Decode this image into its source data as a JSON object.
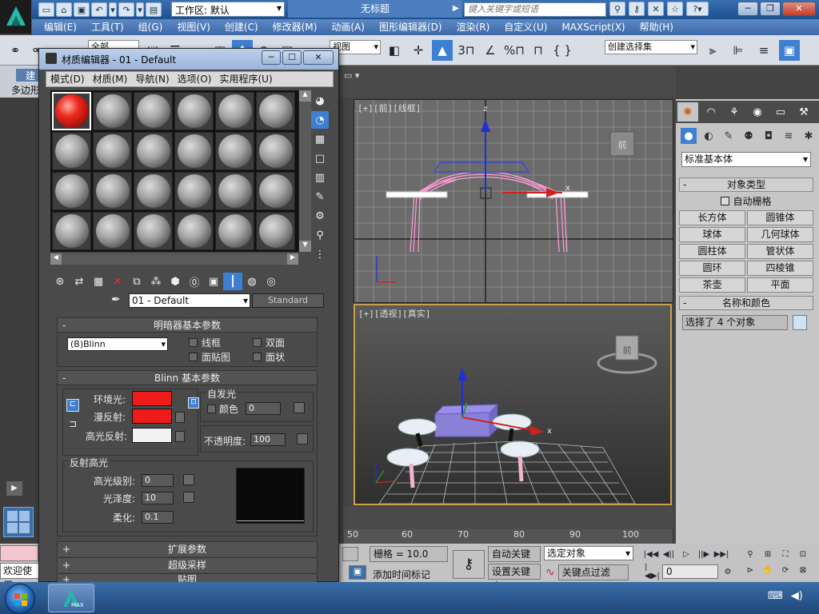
{
  "app": {
    "workspace": "工作区: 默认",
    "doc_title": "无标题",
    "search_placeholder": "键入关键字或短语",
    "menu": [
      "编辑(E)",
      "工具(T)",
      "组(G)",
      "视图(V)",
      "创建(C)",
      "修改器(M)",
      "动画(A)",
      "图形编辑器(D)",
      "渲染(R)",
      "自定义(U)",
      "MAXScript(X)",
      "帮助(H)"
    ]
  },
  "toolbar": {
    "selection_filter": "全部",
    "ref_coord": "视图",
    "named_sel": "创建选择集",
    "snap_3": "3",
    "percent_snap": "%"
  },
  "ribbon": {
    "tab": "建",
    "sub": "多边形"
  },
  "mat_editor": {
    "title": "材质编辑器 - 01 - Default",
    "menu": [
      "模式(D)",
      "材质(M)",
      "导航(N)",
      "选项(O)",
      "实用程序(U)"
    ],
    "material_name": "01 - Default",
    "material_type": "Standard",
    "shader_rollout": "明暗器基本参数",
    "shader": "(B)Blinn",
    "wire": "线框",
    "two_sided": "双面",
    "face_map": "面贴图",
    "faceted": "面状",
    "blinn_rollout": "Blinn 基本参数",
    "self_illum": "自发光",
    "color_label": "颜色",
    "self_illum_value": "0",
    "ambient": "环境光:",
    "diffuse": "漫反射:",
    "specular": "高光反射:",
    "opacity_label": "不透明度:",
    "opacity_value": "100",
    "spec_highlights": "反射高光",
    "spec_level": "高光级别:",
    "spec_level_value": "0",
    "glossiness": "光泽度:",
    "glossiness_value": "10",
    "soften": "柔化:",
    "soften_value": "0.1",
    "ext_rollout": "扩展参数",
    "ss_rollout": "超级采样",
    "maps_rollout": "贴图",
    "colors": {
      "ambient": "#ef1a1a",
      "diffuse": "#ef1a1a",
      "specular": "#f2f2f2",
      "slot1": "#ee2a1f"
    }
  },
  "viewports": {
    "front_label": "[+][前][线框]",
    "persp_label": "[+][透视][真实]",
    "front_cube": "前",
    "persp_cube": "前",
    "axis_z": "z",
    "axis_x": "x"
  },
  "command_panel": {
    "category": "标准基本体",
    "object_type": "对象类型",
    "autogrid": "自动栅格",
    "buttons": [
      "长方体",
      "圆锥体",
      "球体",
      "几何球体",
      "圆柱体",
      "管状体",
      "圆环",
      "四棱锥",
      "茶壶",
      "平面"
    ],
    "name_color": "名称和颜色",
    "selection_text": "选择了 4 个对象",
    "name_color_swatch": "#cfe3f5"
  },
  "ruler": {
    "ticks": [
      "50",
      "60",
      "70",
      "80",
      "90",
      "100"
    ]
  },
  "status": {
    "welcome": "欢迎使用",
    "grid": "栅格 = 10.0",
    "add_time_tag": "添加时间标记",
    "auto_key": "自动关键点",
    "set_key": "设置关键点",
    "selected_obj": "选定对象",
    "key_filters": "关键点过滤器...",
    "frame": "0"
  },
  "taskbar": {
    "max_label": "MAX"
  }
}
